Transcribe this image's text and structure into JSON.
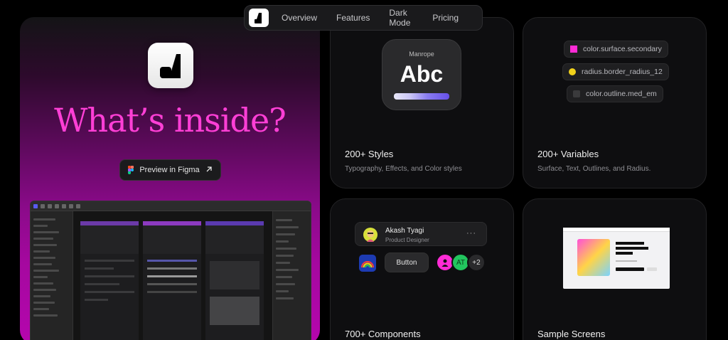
{
  "nav": {
    "items": [
      "Overview",
      "Features",
      "Dark Mode",
      "Pricing"
    ]
  },
  "hero": {
    "title": "What’s inside?",
    "button_label": "Preview in Figma",
    "button_icon": "arrow-up-right-icon"
  },
  "cards": {
    "styles": {
      "font_name": "Manrope",
      "sample": "Abc",
      "title": "200+ Styles",
      "subtitle": "Typography, Effects, and Color styles"
    },
    "variables": {
      "chips": [
        {
          "label": "color.surface.secondary",
          "color": "#ff2bd6"
        },
        {
          "label": "radius.border_radius_12",
          "color": "#f2d21b"
        },
        {
          "label": "color.outline.med_em",
          "color": "#3a3a3c"
        }
      ],
      "title": "200+ Variables",
      "subtitle": "Surface, Text, Outlines, and Radius."
    },
    "components": {
      "profile_name": "Akash Tyagi",
      "profile_role": "Product Designer",
      "more": "···",
      "button_label": "Button",
      "avatar_initials": "AT",
      "avatar_count": "+2",
      "title": "700+ Components"
    },
    "screens": {
      "title": "Sample Screens"
    }
  },
  "colors": {
    "accent": "#ff3fd6",
    "card_bg": "#0e0e10"
  }
}
